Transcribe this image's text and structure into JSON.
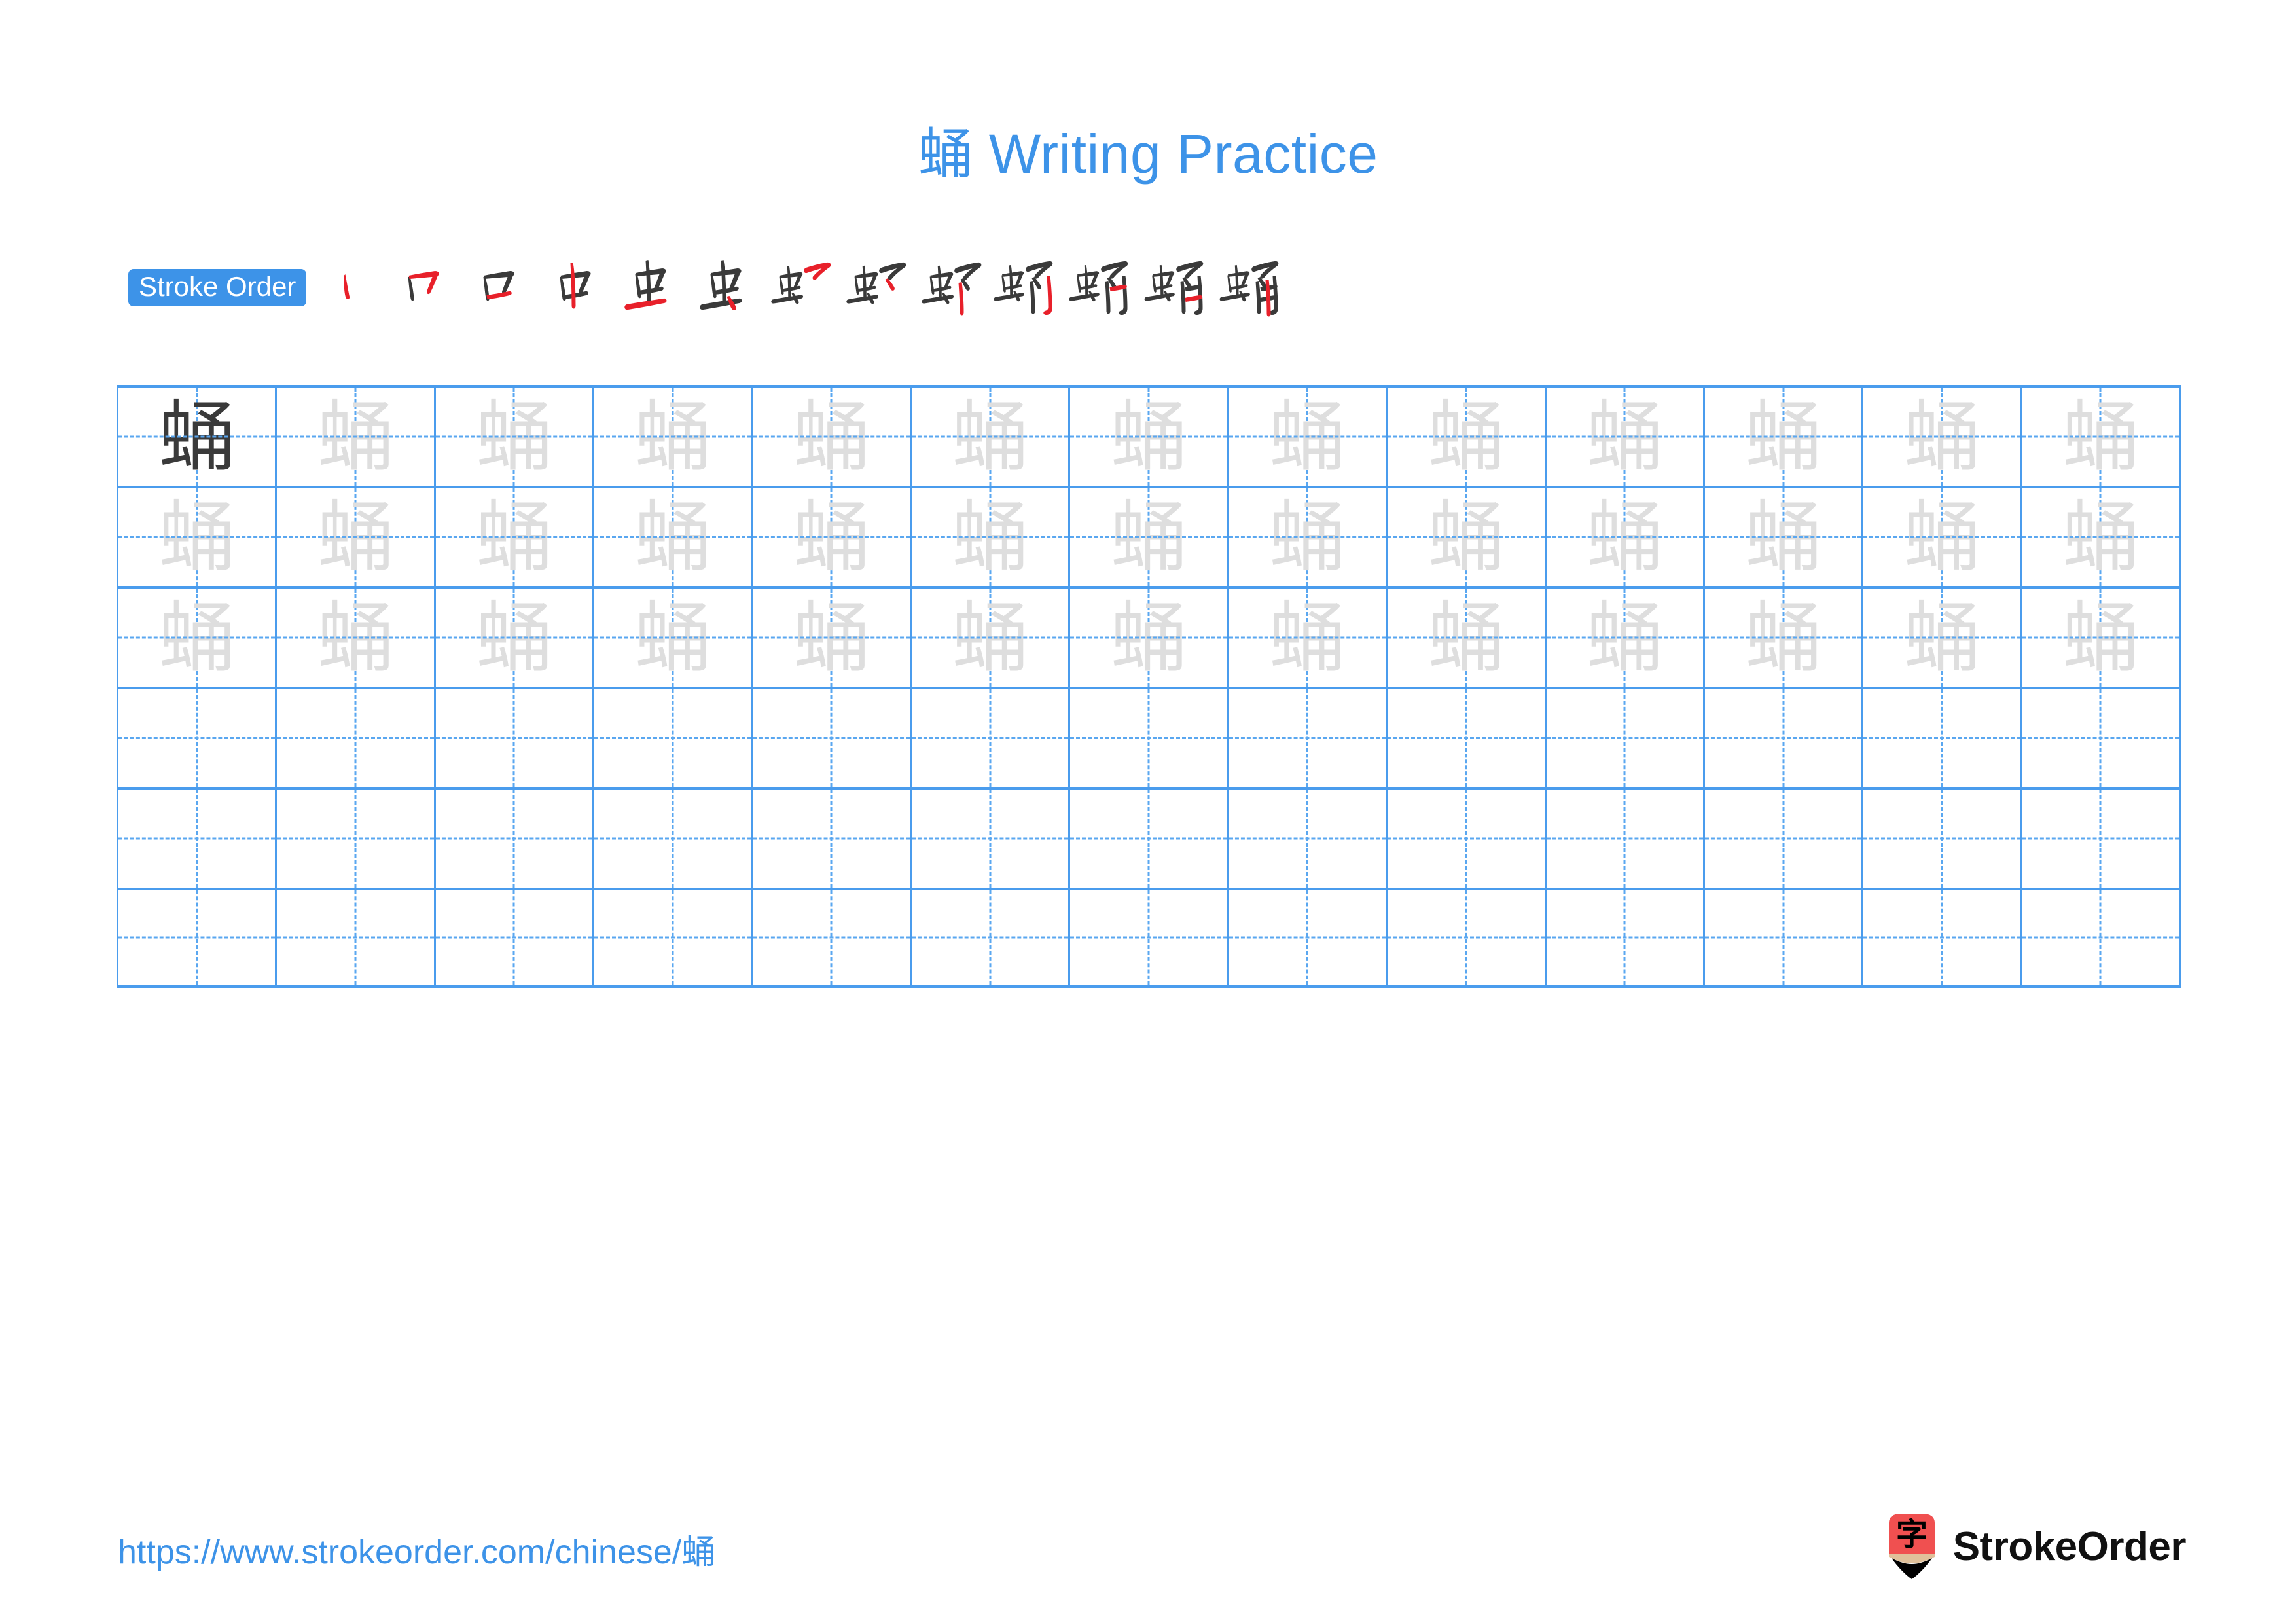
{
  "character": "蛹",
  "colors": {
    "accent_blue": "#3d93e8",
    "grid_blue": "#4a9ced",
    "stroke_new_red": "#e8202a",
    "stroke_prev_dark": "#3a3a3a",
    "trace_gray": "#dedede",
    "logo_red": "#f05050",
    "logo_wood": "#e0c09a"
  },
  "title": {
    "han": "蛹",
    "text": " Writing Practice"
  },
  "stroke_order": {
    "badge_label": "Stroke Order",
    "total_strokes": 13,
    "steps": [
      {
        "index": 1,
        "partial": "丶",
        "new_stroke": "dot"
      },
      {
        "index": 2,
        "partial": "冂",
        "new_stroke": "horizontal-bend"
      },
      {
        "index": 3,
        "partial": "口",
        "new_stroke": "bottom-horizontal"
      },
      {
        "index": 4,
        "partial": "中",
        "new_stroke": "vertical"
      },
      {
        "index": 5,
        "partial": "虫",
        "new_stroke": "long-horizontal"
      },
      {
        "index": 6,
        "partial": "虫",
        "new_stroke": "dot-right"
      },
      {
        "index": 7,
        "partial": "虫乛",
        "new_stroke": "top-bend"
      },
      {
        "index": 8,
        "partial": "虫㇕",
        "new_stroke": "short-hook"
      },
      {
        "index": 9,
        "partial": "虫𠃌",
        "new_stroke": "vertical-down"
      },
      {
        "index": 10,
        "partial": "蛗",
        "new_stroke": "right-vertical-hook"
      },
      {
        "index": 11,
        "partial": "蛹",
        "new_stroke": "inner-horizontal-1"
      },
      {
        "index": 12,
        "partial": "蛹",
        "new_stroke": "inner-horizontal-2"
      },
      {
        "index": 13,
        "partial": "蛹",
        "new_stroke": "center-vertical"
      }
    ]
  },
  "practice_grid": {
    "columns": 13,
    "rows": 6,
    "row_types": [
      "traced-first-dark",
      "traced",
      "traced",
      "blank",
      "blank",
      "blank"
    ],
    "rows_data": [
      [
        "蛹",
        "蛹",
        "蛹",
        "蛹",
        "蛹",
        "蛹",
        "蛹",
        "蛹",
        "蛹",
        "蛹",
        "蛹",
        "蛹",
        "蛹"
      ],
      [
        "蛹",
        "蛹",
        "蛹",
        "蛹",
        "蛹",
        "蛹",
        "蛹",
        "蛹",
        "蛹",
        "蛹",
        "蛹",
        "蛹",
        "蛹"
      ],
      [
        "蛹",
        "蛹",
        "蛹",
        "蛹",
        "蛹",
        "蛹",
        "蛹",
        "蛹",
        "蛹",
        "蛹",
        "蛹",
        "蛹",
        "蛹"
      ],
      [
        "",
        "",
        "",
        "",
        "",
        "",
        "",
        "",
        "",
        "",
        "",
        "",
        ""
      ],
      [
        "",
        "",
        "",
        "",
        "",
        "",
        "",
        "",
        "",
        "",
        "",
        "",
        ""
      ],
      [
        "",
        "",
        "",
        "",
        "",
        "",
        "",
        "",
        "",
        "",
        "",
        "",
        ""
      ]
    ]
  },
  "footer": {
    "url_text": "https://www.strokeorder.com/chinese/",
    "url_han": "蛹",
    "brand_name": "StrokeOrder",
    "logo_glyph": "字"
  }
}
